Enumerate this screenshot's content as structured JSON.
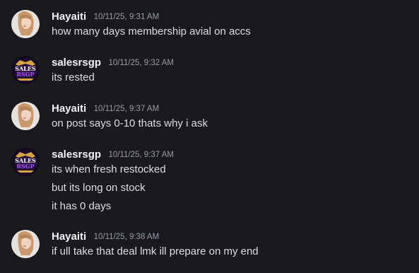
{
  "messages": [
    {
      "username": "Hayaiti",
      "timestamp": "10/11/25, 9:31 AM",
      "avatar": "portrait-avatar",
      "lines": [
        "how many days membership avial on accs"
      ]
    },
    {
      "username": "salesrsgp",
      "timestamp": "10/11/25, 9:32 AM",
      "avatar": "sales-rsgp-logo",
      "avatar_text": [
        "SALES",
        "RSGP"
      ],
      "lines": [
        "its rested"
      ]
    },
    {
      "username": "Hayaiti",
      "timestamp": "10/11/25, 9:37 AM",
      "avatar": "portrait-avatar",
      "lines": [
        "on post says 0-10 thats why i ask"
      ]
    },
    {
      "username": "salesrsgp",
      "timestamp": "10/11/25, 9:37 AM",
      "avatar": "sales-rsgp-logo",
      "avatar_text": [
        "SALES",
        "RSGP"
      ],
      "lines": [
        "its when fresh restocked",
        "but its long on stock",
        "it has 0 days"
      ]
    },
    {
      "username": "Hayaiti",
      "timestamp": "10/11/25, 9:38 AM",
      "avatar": "portrait-avatar",
      "lines": [
        "if ull take that deal lmk ill prepare on my end"
      ]
    }
  ],
  "colors": {
    "background": "#1a1a1e",
    "username": "#f2f3f5",
    "timestamp": "#949ba4",
    "text": "#dbdee1"
  }
}
